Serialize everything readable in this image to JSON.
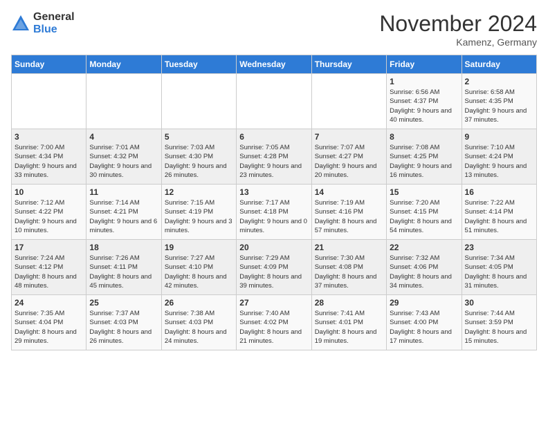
{
  "logo": {
    "general": "General",
    "blue": "Blue"
  },
  "title": "November 2024",
  "location": "Kamenz, Germany",
  "days_of_week": [
    "Sunday",
    "Monday",
    "Tuesday",
    "Wednesday",
    "Thursday",
    "Friday",
    "Saturday"
  ],
  "weeks": [
    [
      {
        "day": "",
        "info": ""
      },
      {
        "day": "",
        "info": ""
      },
      {
        "day": "",
        "info": ""
      },
      {
        "day": "",
        "info": ""
      },
      {
        "day": "",
        "info": ""
      },
      {
        "day": "1",
        "info": "Sunrise: 6:56 AM\nSunset: 4:37 PM\nDaylight: 9 hours and 40 minutes."
      },
      {
        "day": "2",
        "info": "Sunrise: 6:58 AM\nSunset: 4:35 PM\nDaylight: 9 hours and 37 minutes."
      }
    ],
    [
      {
        "day": "3",
        "info": "Sunrise: 7:00 AM\nSunset: 4:34 PM\nDaylight: 9 hours and 33 minutes."
      },
      {
        "day": "4",
        "info": "Sunrise: 7:01 AM\nSunset: 4:32 PM\nDaylight: 9 hours and 30 minutes."
      },
      {
        "day": "5",
        "info": "Sunrise: 7:03 AM\nSunset: 4:30 PM\nDaylight: 9 hours and 26 minutes."
      },
      {
        "day": "6",
        "info": "Sunrise: 7:05 AM\nSunset: 4:28 PM\nDaylight: 9 hours and 23 minutes."
      },
      {
        "day": "7",
        "info": "Sunrise: 7:07 AM\nSunset: 4:27 PM\nDaylight: 9 hours and 20 minutes."
      },
      {
        "day": "8",
        "info": "Sunrise: 7:08 AM\nSunset: 4:25 PM\nDaylight: 9 hours and 16 minutes."
      },
      {
        "day": "9",
        "info": "Sunrise: 7:10 AM\nSunset: 4:24 PM\nDaylight: 9 hours and 13 minutes."
      }
    ],
    [
      {
        "day": "10",
        "info": "Sunrise: 7:12 AM\nSunset: 4:22 PM\nDaylight: 9 hours and 10 minutes."
      },
      {
        "day": "11",
        "info": "Sunrise: 7:14 AM\nSunset: 4:21 PM\nDaylight: 9 hours and 6 minutes."
      },
      {
        "day": "12",
        "info": "Sunrise: 7:15 AM\nSunset: 4:19 PM\nDaylight: 9 hours and 3 minutes."
      },
      {
        "day": "13",
        "info": "Sunrise: 7:17 AM\nSunset: 4:18 PM\nDaylight: 9 hours and 0 minutes."
      },
      {
        "day": "14",
        "info": "Sunrise: 7:19 AM\nSunset: 4:16 PM\nDaylight: 8 hours and 57 minutes."
      },
      {
        "day": "15",
        "info": "Sunrise: 7:20 AM\nSunset: 4:15 PM\nDaylight: 8 hours and 54 minutes."
      },
      {
        "day": "16",
        "info": "Sunrise: 7:22 AM\nSunset: 4:14 PM\nDaylight: 8 hours and 51 minutes."
      }
    ],
    [
      {
        "day": "17",
        "info": "Sunrise: 7:24 AM\nSunset: 4:12 PM\nDaylight: 8 hours and 48 minutes."
      },
      {
        "day": "18",
        "info": "Sunrise: 7:26 AM\nSunset: 4:11 PM\nDaylight: 8 hours and 45 minutes."
      },
      {
        "day": "19",
        "info": "Sunrise: 7:27 AM\nSunset: 4:10 PM\nDaylight: 8 hours and 42 minutes."
      },
      {
        "day": "20",
        "info": "Sunrise: 7:29 AM\nSunset: 4:09 PM\nDaylight: 8 hours and 39 minutes."
      },
      {
        "day": "21",
        "info": "Sunrise: 7:30 AM\nSunset: 4:08 PM\nDaylight: 8 hours and 37 minutes."
      },
      {
        "day": "22",
        "info": "Sunrise: 7:32 AM\nSunset: 4:06 PM\nDaylight: 8 hours and 34 minutes."
      },
      {
        "day": "23",
        "info": "Sunrise: 7:34 AM\nSunset: 4:05 PM\nDaylight: 8 hours and 31 minutes."
      }
    ],
    [
      {
        "day": "24",
        "info": "Sunrise: 7:35 AM\nSunset: 4:04 PM\nDaylight: 8 hours and 29 minutes."
      },
      {
        "day": "25",
        "info": "Sunrise: 7:37 AM\nSunset: 4:03 PM\nDaylight: 8 hours and 26 minutes."
      },
      {
        "day": "26",
        "info": "Sunrise: 7:38 AM\nSunset: 4:03 PM\nDaylight: 8 hours and 24 minutes."
      },
      {
        "day": "27",
        "info": "Sunrise: 7:40 AM\nSunset: 4:02 PM\nDaylight: 8 hours and 21 minutes."
      },
      {
        "day": "28",
        "info": "Sunrise: 7:41 AM\nSunset: 4:01 PM\nDaylight: 8 hours and 19 minutes."
      },
      {
        "day": "29",
        "info": "Sunrise: 7:43 AM\nSunset: 4:00 PM\nDaylight: 8 hours and 17 minutes."
      },
      {
        "day": "30",
        "info": "Sunrise: 7:44 AM\nSunset: 3:59 PM\nDaylight: 8 hours and 15 minutes."
      }
    ]
  ]
}
